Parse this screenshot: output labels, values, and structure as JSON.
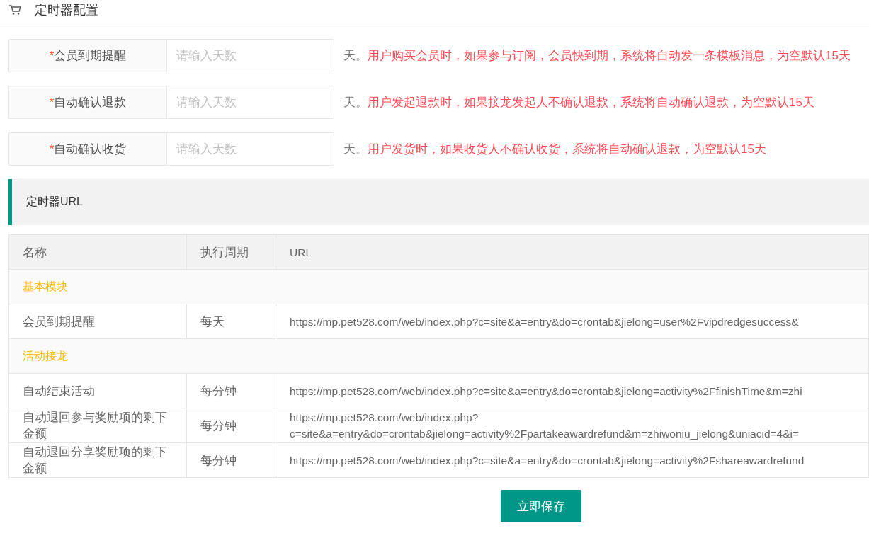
{
  "header": {
    "title": "定时器配置"
  },
  "fields": [
    {
      "label": "会员到期提醒",
      "required_mark": "*",
      "placeholder": "请输入天数",
      "unit": "天。",
      "hint": "用户购买会员时，如果参与订阅，会员快到期，系统将自动发一条模板消息，为空默认15天"
    },
    {
      "label": "自动确认退款",
      "required_mark": "*",
      "placeholder": "请输入天数",
      "unit": "天。",
      "hint": "用户发起退款时，如果接龙发起人不确认退款，系统将自动确认退款，为空默认15天"
    },
    {
      "label": "自动确认收货",
      "required_mark": "*",
      "placeholder": "请输入天数",
      "unit": "天。",
      "hint": "用户发货时，如果收货人不确认收货，系统将自动确认退款，为空默认15天"
    }
  ],
  "section": {
    "title": "定时器URL"
  },
  "table": {
    "columns": [
      "名称",
      "执行周期",
      "URL"
    ],
    "rows": [
      {
        "kind": "group",
        "name": "基本模块"
      },
      {
        "kind": "item",
        "name": "会员到期提醒",
        "period": "每天",
        "url": "https://mp.pet528.com/web/index.php?c=site&a=entry&do=crontab&jielong=user%2Fvipdredgesuccess&"
      },
      {
        "kind": "group",
        "name": "活动接龙"
      },
      {
        "kind": "item",
        "name": "自动结束活动",
        "period": "每分钟",
        "url": "https://mp.pet528.com/web/index.php?c=site&a=entry&do=crontab&jielong=activity%2FfinishTime&m=zhi"
      },
      {
        "kind": "item",
        "name": "自动退回参与奖励项的剩下金额",
        "period": "每分钟",
        "url": "https://mp.pet528.com/web/index.php?\nc=site&a=entry&do=crontab&jielong=activity%2Fpartakeawardrefund&m=zhiwoniu_jielong&uniacid=4&i="
      },
      {
        "kind": "item",
        "name": "自动退回分享奖励项的剩下金额",
        "period": "每分钟",
        "url": "https://mp.pet528.com/web/index.php?c=site&a=entry&do=crontab&jielong=activity%2Fshareawardrefund"
      }
    ]
  },
  "save_button": "立即保存"
}
